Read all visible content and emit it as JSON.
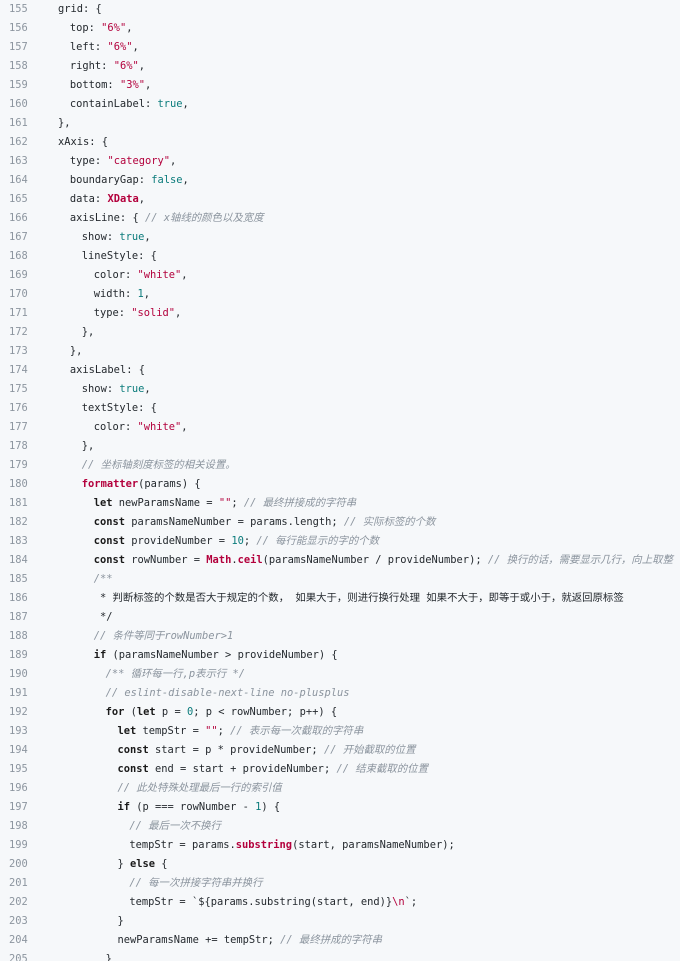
{
  "lines": [
    {
      "no": "155",
      "indent": 2,
      "tokens": [
        {
          "t": "grid: {",
          "c": "id"
        }
      ]
    },
    {
      "no": "156",
      "indent": 3,
      "tokens": [
        {
          "t": "top: ",
          "c": "id"
        },
        {
          "t": "\"6%\"",
          "c": "s"
        },
        {
          "t": ",",
          "c": "id"
        }
      ]
    },
    {
      "no": "157",
      "indent": 3,
      "tokens": [
        {
          "t": "left: ",
          "c": "id"
        },
        {
          "t": "\"6%\"",
          "c": "s"
        },
        {
          "t": ",",
          "c": "id"
        }
      ]
    },
    {
      "no": "158",
      "indent": 3,
      "tokens": [
        {
          "t": "right: ",
          "c": "id"
        },
        {
          "t": "\"6%\"",
          "c": "s"
        },
        {
          "t": ",",
          "c": "id"
        }
      ]
    },
    {
      "no": "159",
      "indent": 3,
      "tokens": [
        {
          "t": "bottom: ",
          "c": "id"
        },
        {
          "t": "\"3%\"",
          "c": "s"
        },
        {
          "t": ",",
          "c": "id"
        }
      ]
    },
    {
      "no": "160",
      "indent": 3,
      "tokens": [
        {
          "t": "containLabel: ",
          "c": "id"
        },
        {
          "t": "true",
          "c": "n"
        },
        {
          "t": ",",
          "c": "id"
        }
      ]
    },
    {
      "no": "161",
      "indent": 2,
      "tokens": [
        {
          "t": "},",
          "c": "id"
        }
      ]
    },
    {
      "no": "162",
      "indent": 2,
      "tokens": [
        {
          "t": "xAxis: {",
          "c": "id"
        }
      ]
    },
    {
      "no": "163",
      "indent": 3,
      "tokens": [
        {
          "t": "type: ",
          "c": "id"
        },
        {
          "t": "\"category\"",
          "c": "s"
        },
        {
          "t": ",",
          "c": "id"
        }
      ]
    },
    {
      "no": "164",
      "indent": 3,
      "tokens": [
        {
          "t": "boundaryGap: ",
          "c": "id"
        },
        {
          "t": "false",
          "c": "n"
        },
        {
          "t": ",",
          "c": "id"
        }
      ]
    },
    {
      "no": "165",
      "indent": 3,
      "tokens": [
        {
          "t": "data: ",
          "c": "id"
        },
        {
          "t": "XData",
          "c": "b"
        },
        {
          "t": ",",
          "c": "id"
        }
      ]
    },
    {
      "no": "166",
      "indent": 3,
      "tokens": [
        {
          "t": "axisLine: { ",
          "c": "id"
        },
        {
          "t": "// x轴线的颜色以及宽度",
          "c": "c"
        }
      ]
    },
    {
      "no": "167",
      "indent": 4,
      "tokens": [
        {
          "t": "show: ",
          "c": "id"
        },
        {
          "t": "true",
          "c": "n"
        },
        {
          "t": ",",
          "c": "id"
        }
      ]
    },
    {
      "no": "168",
      "indent": 4,
      "tokens": [
        {
          "t": "lineStyle: {",
          "c": "id"
        }
      ]
    },
    {
      "no": "169",
      "indent": 5,
      "tokens": [
        {
          "t": "color: ",
          "c": "id"
        },
        {
          "t": "\"white\"",
          "c": "s"
        },
        {
          "t": ",",
          "c": "id"
        }
      ]
    },
    {
      "no": "170",
      "indent": 5,
      "tokens": [
        {
          "t": "width: ",
          "c": "id"
        },
        {
          "t": "1",
          "c": "n"
        },
        {
          "t": ",",
          "c": "id"
        }
      ]
    },
    {
      "no": "171",
      "indent": 5,
      "tokens": [
        {
          "t": "type: ",
          "c": "id"
        },
        {
          "t": "\"solid\"",
          "c": "s"
        },
        {
          "t": ",",
          "c": "id"
        }
      ]
    },
    {
      "no": "172",
      "indent": 4,
      "tokens": [
        {
          "t": "},",
          "c": "id"
        }
      ]
    },
    {
      "no": "173",
      "indent": 3,
      "tokens": [
        {
          "t": "},",
          "c": "id"
        }
      ]
    },
    {
      "no": "174",
      "indent": 3,
      "tokens": [
        {
          "t": "axisLabel: {",
          "c": "id"
        }
      ]
    },
    {
      "no": "175",
      "indent": 4,
      "tokens": [
        {
          "t": "show: ",
          "c": "id"
        },
        {
          "t": "true",
          "c": "n"
        },
        {
          "t": ",",
          "c": "id"
        }
      ]
    },
    {
      "no": "176",
      "indent": 4,
      "tokens": [
        {
          "t": "textStyle: {",
          "c": "id"
        }
      ]
    },
    {
      "no": "177",
      "indent": 5,
      "tokens": [
        {
          "t": "color: ",
          "c": "id"
        },
        {
          "t": "\"white\"",
          "c": "s"
        },
        {
          "t": ",",
          "c": "id"
        }
      ]
    },
    {
      "no": "178",
      "indent": 4,
      "tokens": [
        {
          "t": "},",
          "c": "id"
        }
      ]
    },
    {
      "no": "179",
      "indent": 4,
      "tokens": [
        {
          "t": "// 坐标轴刻度标签的相关设置。",
          "c": "c"
        }
      ]
    },
    {
      "no": "180",
      "indent": 4,
      "tokens": [
        {
          "t": "formatter",
          "c": "fn"
        },
        {
          "t": "(params) {",
          "c": "id"
        }
      ]
    },
    {
      "no": "181",
      "indent": 5,
      "tokens": [
        {
          "t": "let",
          "c": "kw"
        },
        {
          "t": " newParamsName = ",
          "c": "id"
        },
        {
          "t": "\"\"",
          "c": "s"
        },
        {
          "t": "; ",
          "c": "id"
        },
        {
          "t": "// 最终拼接成的字符串",
          "c": "c"
        }
      ]
    },
    {
      "no": "182",
      "indent": 5,
      "tokens": [
        {
          "t": "const",
          "c": "kw"
        },
        {
          "t": " paramsNameNumber = params.length; ",
          "c": "id"
        },
        {
          "t": "// 实际标签的个数",
          "c": "c"
        }
      ]
    },
    {
      "no": "183",
      "indent": 5,
      "tokens": [
        {
          "t": "const",
          "c": "kw"
        },
        {
          "t": " provideNumber = ",
          "c": "id"
        },
        {
          "t": "10",
          "c": "n"
        },
        {
          "t": "; ",
          "c": "id"
        },
        {
          "t": "// 每行能显示的字的个数",
          "c": "c"
        }
      ]
    },
    {
      "no": "184",
      "indent": 5,
      "tokens": [
        {
          "t": "const",
          "c": "kw"
        },
        {
          "t": " rowNumber = ",
          "c": "id"
        },
        {
          "t": "Math",
          "c": "b"
        },
        {
          "t": ".",
          "c": "id"
        },
        {
          "t": "ceil",
          "c": "fn"
        },
        {
          "t": "(paramsNameNumber / provideNumber); ",
          "c": "id"
        },
        {
          "t": "// 换行的话，需要显示几行，向上取整",
          "c": "c"
        }
      ]
    },
    {
      "no": "185",
      "indent": 5,
      "tokens": [
        {
          "t": "/**",
          "c": "c"
        }
      ]
    },
    {
      "no": "186",
      "indent": 5,
      "tokens": [
        {
          "t": " * 判断标签的个数是否大于规定的个数， 如果大于，则进行换行处理 如果不大于，即等于或小于，就返回原标签",
          "c": "id"
        }
      ]
    },
    {
      "no": "187",
      "indent": 5,
      "tokens": [
        {
          "t": " */",
          "c": "id"
        }
      ]
    },
    {
      "no": "188",
      "indent": 5,
      "tokens": [
        {
          "t": "// 条件等同于rowNumber>1",
          "c": "c"
        }
      ]
    },
    {
      "no": "189",
      "indent": 5,
      "tokens": [
        {
          "t": "if",
          "c": "kw"
        },
        {
          "t": " (paramsNameNumber > provideNumber) {",
          "c": "id"
        }
      ]
    },
    {
      "no": "190",
      "indent": 6,
      "tokens": [
        {
          "t": "/** 循环每一行,p表示行 */",
          "c": "c"
        }
      ]
    },
    {
      "no": "191",
      "indent": 6,
      "tokens": [
        {
          "t": "// eslint-disable-next-line no-plusplus",
          "c": "c"
        }
      ]
    },
    {
      "no": "192",
      "indent": 6,
      "tokens": [
        {
          "t": "for",
          "c": "kw"
        },
        {
          "t": " (",
          "c": "id"
        },
        {
          "t": "let",
          "c": "kw"
        },
        {
          "t": " p = ",
          "c": "id"
        },
        {
          "t": "0",
          "c": "n"
        },
        {
          "t": "; p < rowNumber; p++) {",
          "c": "id"
        }
      ]
    },
    {
      "no": "193",
      "indent": 7,
      "tokens": [
        {
          "t": "let",
          "c": "kw"
        },
        {
          "t": " tempStr = ",
          "c": "id"
        },
        {
          "t": "\"\"",
          "c": "s"
        },
        {
          "t": "; ",
          "c": "id"
        },
        {
          "t": "// 表示每一次截取的字符串",
          "c": "c"
        }
      ]
    },
    {
      "no": "194",
      "indent": 7,
      "tokens": [
        {
          "t": "const",
          "c": "kw"
        },
        {
          "t": " start = p * provideNumber; ",
          "c": "id"
        },
        {
          "t": "// 开始截取的位置",
          "c": "c"
        }
      ]
    },
    {
      "no": "195",
      "indent": 7,
      "tokens": [
        {
          "t": "const",
          "c": "kw"
        },
        {
          "t": " end = start + provideNumber; ",
          "c": "id"
        },
        {
          "t": "// 结束截取的位置",
          "c": "c"
        }
      ]
    },
    {
      "no": "196",
      "indent": 7,
      "tokens": [
        {
          "t": "// 此处特殊处理最后一行的索引值",
          "c": "c"
        }
      ]
    },
    {
      "no": "197",
      "indent": 7,
      "tokens": [
        {
          "t": "if",
          "c": "kw"
        },
        {
          "t": " (p === rowNumber - ",
          "c": "id"
        },
        {
          "t": "1",
          "c": "n"
        },
        {
          "t": ") {",
          "c": "id"
        }
      ]
    },
    {
      "no": "198",
      "indent": 8,
      "tokens": [
        {
          "t": "// 最后一次不换行",
          "c": "c"
        }
      ]
    },
    {
      "no": "199",
      "indent": 8,
      "tokens": [
        {
          "t": "tempStr = params.",
          "c": "id"
        },
        {
          "t": "substring",
          "c": "fn"
        },
        {
          "t": "(start, paramsNameNumber);",
          "c": "id"
        }
      ]
    },
    {
      "no": "200",
      "indent": 7,
      "tokens": [
        {
          "t": "} ",
          "c": "id"
        },
        {
          "t": "else",
          "c": "kw"
        },
        {
          "t": " {",
          "c": "id"
        }
      ]
    },
    {
      "no": "201",
      "indent": 8,
      "tokens": [
        {
          "t": "// 每一次拼接字符串并换行",
          "c": "c"
        }
      ]
    },
    {
      "no": "202",
      "indent": 8,
      "tokens": [
        {
          "t": "tempStr = `${params.substring(start, end)}",
          "c": "id"
        },
        {
          "t": "\\n",
          "c": "s"
        },
        {
          "t": "`;",
          "c": "id"
        }
      ]
    },
    {
      "no": "203",
      "indent": 7,
      "tokens": [
        {
          "t": "}",
          "c": "id"
        }
      ]
    },
    {
      "no": "204",
      "indent": 7,
      "tokens": [
        {
          "t": "newParamsName += tempStr; ",
          "c": "id"
        },
        {
          "t": "// 最终拼成的字符串",
          "c": "c"
        }
      ]
    },
    {
      "no": "205",
      "indent": 6,
      "tokens": [
        {
          "t": "}",
          "c": "id"
        }
      ]
    }
  ]
}
